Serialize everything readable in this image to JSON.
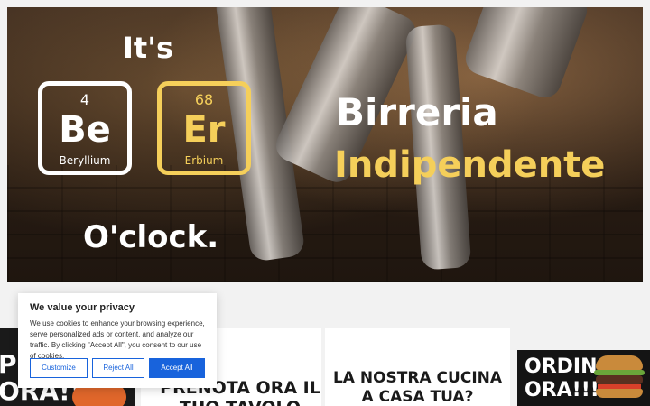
{
  "hero": {
    "its": "It's",
    "oclock": "O'clock.",
    "title_line1": "Birreria",
    "title_line2": "Indipendente",
    "elements": [
      {
        "number": "4",
        "symbol": "Be",
        "name": "Beryllium",
        "color": "#ffffff"
      },
      {
        "number": "68",
        "symbol": "Er",
        "name": "Erbium",
        "color": "#f5cf5a"
      }
    ]
  },
  "cards": {
    "left_promo_text": "PR\nORA!!",
    "book_table": "PRENOTA ORA IL TUO TAVOLO",
    "kitchen": "LA NOSTRA CUCINA A CASA TUA?",
    "order_now": "ORDINA\nORA!!!"
  },
  "cookie": {
    "title": "We value your privacy",
    "body": "We use cookies to enhance your browsing experience, serve personalized ads or content, and analyze our traffic. By clicking \"Accept All\", you consent to our use of cookies.",
    "customize": "Customize",
    "reject": "Reject All",
    "accept": "Accept All",
    "accent_color": "#1863dc"
  }
}
